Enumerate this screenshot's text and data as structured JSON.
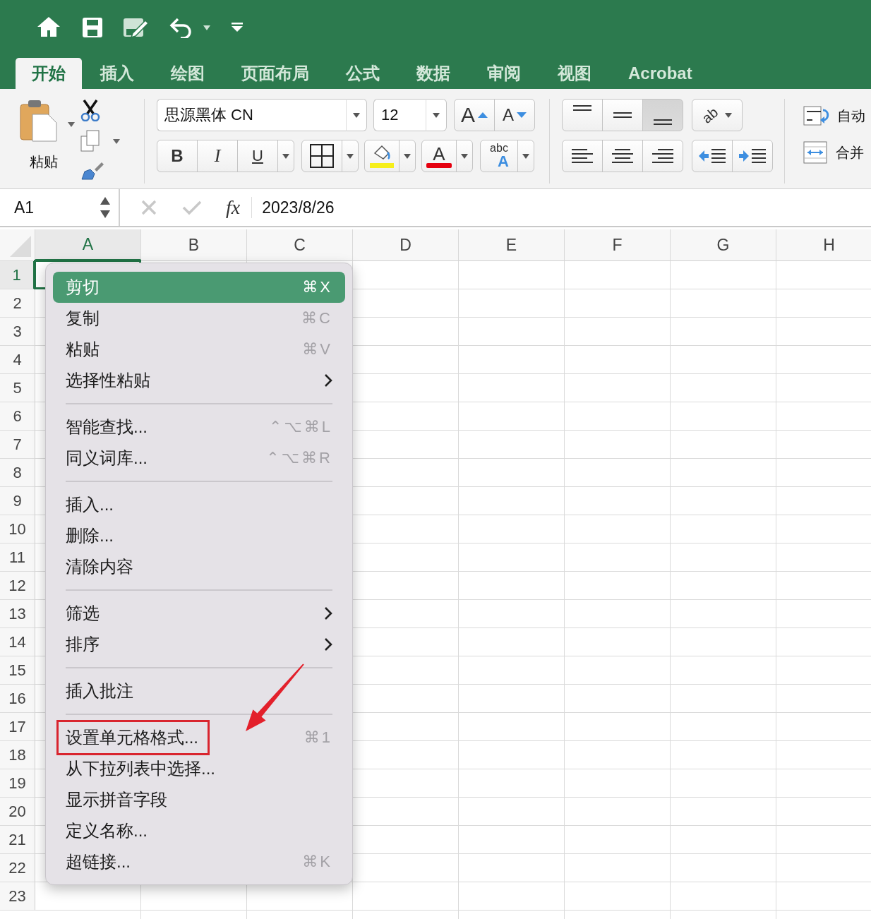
{
  "tabs": [
    {
      "label": "开始",
      "selected": true
    },
    {
      "label": "插入",
      "selected": false
    },
    {
      "label": "绘图",
      "selected": false
    },
    {
      "label": "页面布局",
      "selected": false
    },
    {
      "label": "公式",
      "selected": false
    },
    {
      "label": "数据",
      "selected": false
    },
    {
      "label": "审阅",
      "selected": false
    },
    {
      "label": "视图",
      "selected": false
    },
    {
      "label": "Acrobat",
      "selected": false
    }
  ],
  "ribbon": {
    "paste_label": "粘贴",
    "font": {
      "name": "思源黑体 CN",
      "size": "12",
      "grow_label": "A",
      "shrink_label": "A",
      "bold_label": "B",
      "italic_label": "I",
      "underline_label": "U",
      "color_label": "A",
      "phonetic_label": "abc",
      "phonetic_letter": "A"
    },
    "vertical_alignment": [
      {
        "kind": "top",
        "selected": false
      },
      {
        "kind": "middle",
        "selected": false
      },
      {
        "kind": "bottom",
        "selected": true
      }
    ],
    "orientation_label": "ab",
    "horizontal_alignment": [
      {
        "kind": "left",
        "selected": false
      },
      {
        "kind": "center",
        "selected": false
      },
      {
        "kind": "right",
        "selected": false
      }
    ],
    "wrap_text_label": "自动",
    "merge_label": "合并"
  },
  "formula_bar": {
    "name_box": "A1",
    "function_label": "fx",
    "formula": "2023/8/26"
  },
  "sheet": {
    "columns": [
      {
        "label": "A",
        "selected": true
      },
      {
        "label": "B",
        "selected": false
      },
      {
        "label": "C",
        "selected": false
      },
      {
        "label": "D",
        "selected": false
      },
      {
        "label": "E",
        "selected": false
      },
      {
        "label": "F",
        "selected": false
      },
      {
        "label": "G",
        "selected": false
      },
      {
        "label": "H",
        "selected": false
      }
    ],
    "rows": [
      {
        "label": "1",
        "selected": true
      },
      {
        "label": "2",
        "selected": false
      },
      {
        "label": "3",
        "selected": false
      },
      {
        "label": "4",
        "selected": false
      },
      {
        "label": "5",
        "selected": false
      },
      {
        "label": "6",
        "selected": false
      },
      {
        "label": "7",
        "selected": false
      },
      {
        "label": "8",
        "selected": false
      },
      {
        "label": "9",
        "selected": false
      },
      {
        "label": "10",
        "selected": false
      },
      {
        "label": "11",
        "selected": false
      },
      {
        "label": "12",
        "selected": false
      },
      {
        "label": "13",
        "selected": false
      },
      {
        "label": "14",
        "selected": false
      },
      {
        "label": "15",
        "selected": false
      },
      {
        "label": "16",
        "selected": false
      },
      {
        "label": "17",
        "selected": false
      },
      {
        "label": "18",
        "selected": false
      },
      {
        "label": "19",
        "selected": false
      },
      {
        "label": "20",
        "selected": false
      },
      {
        "label": "21",
        "selected": false
      },
      {
        "label": "22",
        "selected": false
      },
      {
        "label": "23",
        "selected": false
      }
    ]
  },
  "context_menu": {
    "groups": [
      {
        "items": [
          {
            "label": "剪切",
            "kind": "command",
            "shortcut": "⌘X",
            "selected": true,
            "marked": false
          },
          {
            "label": "复制",
            "kind": "command",
            "shortcut": "⌘C",
            "selected": false,
            "marked": false
          },
          {
            "label": "粘贴",
            "kind": "command",
            "shortcut": "⌘V",
            "selected": false,
            "marked": false
          },
          {
            "label": "选择性粘贴",
            "kind": "submenu",
            "selected": false,
            "marked": false
          }
        ]
      },
      {
        "items": [
          {
            "label": "智能查找...",
            "kind": "command",
            "shortcut": "⌃⌥⌘L",
            "selected": false,
            "marked": false
          },
          {
            "label": "同义词库...",
            "kind": "command",
            "shortcut": "⌃⌥⌘R",
            "selected": false,
            "marked": false
          }
        ]
      },
      {
        "items": [
          {
            "label": "插入...",
            "kind": "command",
            "selected": false,
            "marked": false
          },
          {
            "label": "删除...",
            "kind": "command",
            "selected": false,
            "marked": false
          },
          {
            "label": "清除内容",
            "kind": "command",
            "selected": false,
            "marked": false
          }
        ]
      },
      {
        "items": [
          {
            "label": "筛选",
            "kind": "submenu",
            "selected": false,
            "marked": false
          },
          {
            "label": "排序",
            "kind": "submenu",
            "selected": false,
            "marked": false
          }
        ]
      },
      {
        "items": [
          {
            "label": "插入批注",
            "kind": "command",
            "selected": false,
            "marked": false
          }
        ]
      },
      {
        "items": [
          {
            "label": "设置单元格格式...",
            "kind": "command",
            "shortcut": "⌘1",
            "selected": false,
            "marked": true
          },
          {
            "label": "从下拉列表中选择...",
            "kind": "command",
            "selected": false,
            "marked": false
          },
          {
            "label": "显示拼音字段",
            "kind": "command",
            "selected": false,
            "marked": false
          },
          {
            "label": "定义名称...",
            "kind": "command",
            "selected": false,
            "marked": false
          },
          {
            "label": "超链接...",
            "kind": "command",
            "shortcut": "⌘K",
            "selected": false,
            "marked": false
          }
        ]
      }
    ]
  }
}
